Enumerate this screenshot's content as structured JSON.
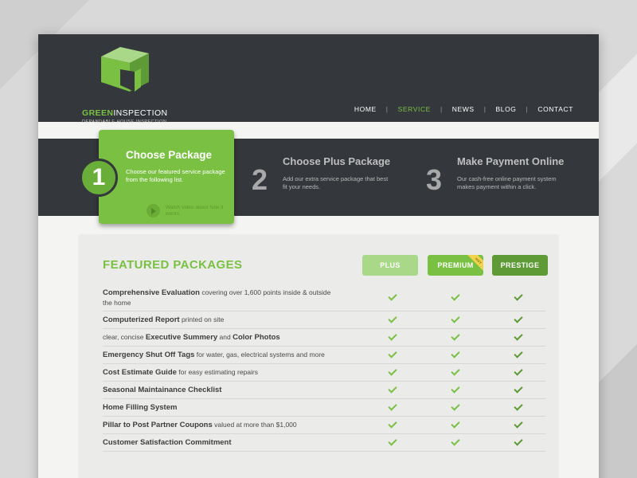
{
  "brand": {
    "name_green": "GREEN",
    "name_white": "INSPECTION",
    "tagline": "DEPANDABLE HOUSE INSPECTION",
    "colors": {
      "green": "#7ac143",
      "dark": "#34373b"
    }
  },
  "nav": {
    "items": [
      {
        "label": "HOME",
        "active": false
      },
      {
        "label": "SERVICE",
        "active": true
      },
      {
        "label": "NEWS",
        "active": false
      },
      {
        "label": "BLOG",
        "active": false
      },
      {
        "label": "CONTACT",
        "active": false
      }
    ],
    "separator": "|"
  },
  "steps": [
    {
      "number": "1",
      "title": "Choose Package",
      "desc": "Choose our featured service package from the following list.",
      "video_label": "Watch video about how it works",
      "active": true
    },
    {
      "number": "2",
      "title": "Choose Plus Package",
      "desc": "Add our extra service package that best fit your needs.",
      "active": false
    },
    {
      "number": "3",
      "title": "Make Payment Online",
      "desc": "Our cash-free online payment system makes payment within a click.",
      "active": false
    }
  ],
  "packages": {
    "title": "FEATURED PACKAGES",
    "plans": [
      {
        "label": "PLUS"
      },
      {
        "label": "PREMIUM",
        "ribbon": "HOT"
      },
      {
        "label": "PRESTIGE"
      }
    ],
    "features": [
      {
        "bold_pre": "",
        "bold": "Comprehensive Evaluation",
        "rest": " covering over 1,600 points inside & outside the home"
      },
      {
        "bold_pre": "",
        "bold": "Computerized Report",
        "rest": " printed on site"
      },
      {
        "bold_pre": "clear, concise ",
        "bold": "Executive Summery",
        "rest": " and ",
        "bold2": "Color Photos"
      },
      {
        "bold_pre": "",
        "bold": "Emergency Shut Off Tags",
        "rest": " for water, gas, electrical systems and more"
      },
      {
        "bold_pre": "",
        "bold": "Cost Estimate Guide",
        "rest": " for easy estimating repairs"
      },
      {
        "bold_pre": "",
        "bold": "Seasonal Maintainance Checklist",
        "rest": ""
      },
      {
        "bold_pre": "",
        "bold": "Home Filling System",
        "rest": ""
      },
      {
        "bold_pre": "",
        "bold": "Pillar to Post Partner Coupons",
        "rest": " valued at more than $1,000"
      },
      {
        "bold_pre": "",
        "bold": "Customer Satisfaction Commitment",
        "rest": ""
      }
    ]
  }
}
